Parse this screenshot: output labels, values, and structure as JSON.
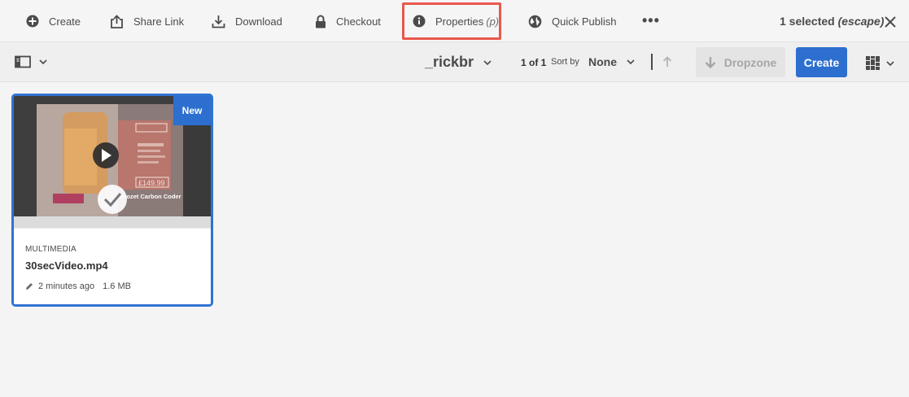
{
  "actionbar": {
    "create": "Create",
    "share_link": "Share Link",
    "download": "Download",
    "checkout": "Checkout",
    "properties": "Properties",
    "properties_shortcut": "(p)",
    "quick_publish": "Quick Publish",
    "more": "•••",
    "selection_count": "1 selected",
    "selection_hint": "(escape)"
  },
  "toolbar": {
    "folder_name": "_rickbr",
    "page_info": "1 of 1",
    "sort_label": "Sort by",
    "sort_value": "None",
    "dropzone_label": "Dropzone",
    "create_label": "Create"
  },
  "card": {
    "badge": "New",
    "type": "MULTIMEDIA",
    "filename": "30secVideo.mp4",
    "modified": "2 minutes ago",
    "size": "1.6 MB",
    "thumbnail_caption": "Ghozet Carbon Coder",
    "thumbnail_price": "£149.99"
  },
  "colors": {
    "accent": "#2d6fcf",
    "selection_border": "#3073d3",
    "highlight": "#e8584c"
  }
}
